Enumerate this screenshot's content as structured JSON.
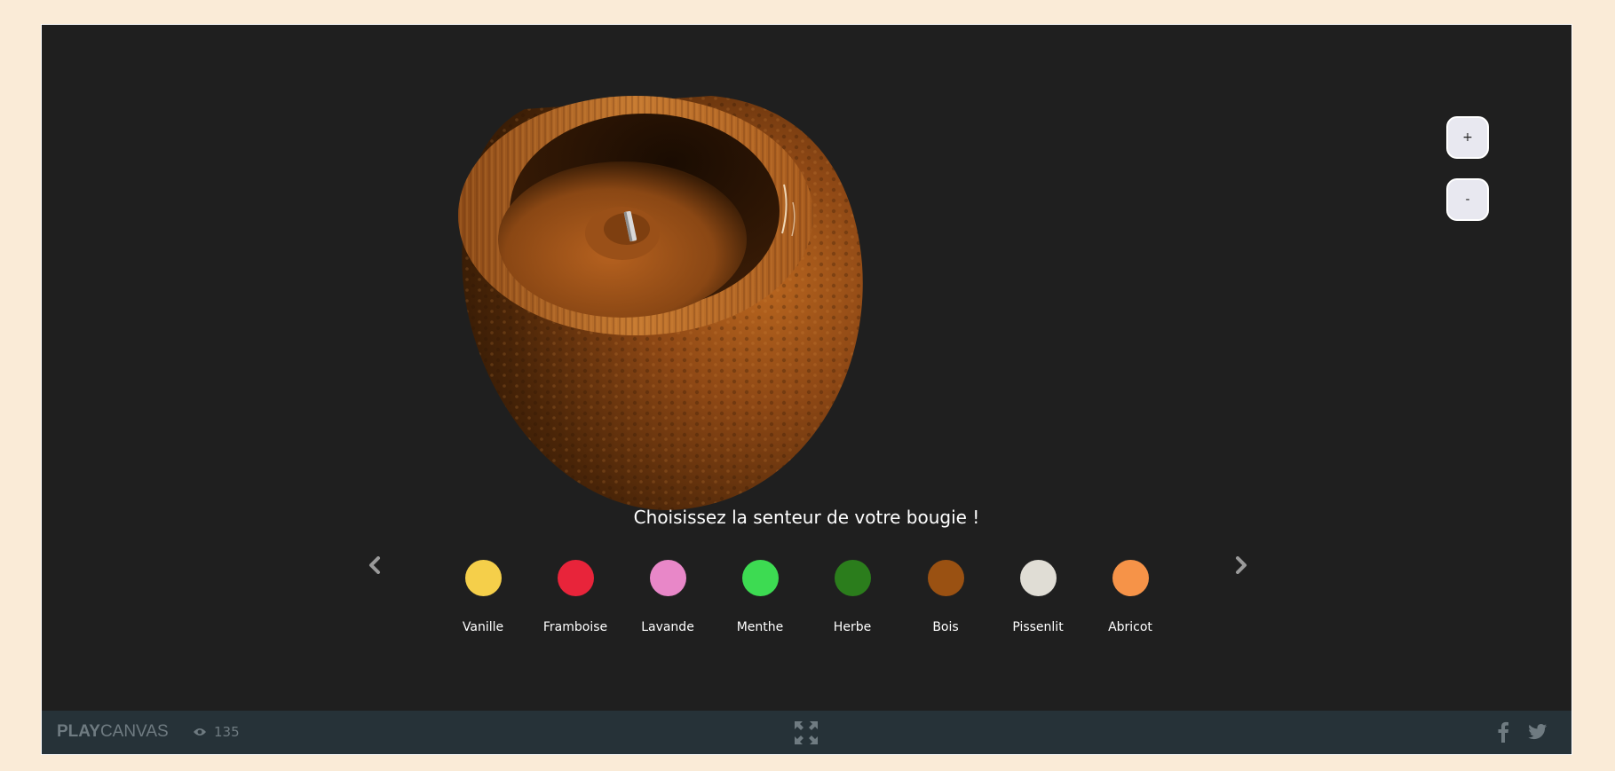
{
  "zoom": {
    "plus_label": "+",
    "minus_label": "-"
  },
  "prompt": "Choisissez la senteur de votre bougie !",
  "scents": [
    {
      "name": "Vanille",
      "color": "#f5cf4a"
    },
    {
      "name": "Framboise",
      "color": "#e8243a"
    },
    {
      "name": "Lavande",
      "color": "#e887c8"
    },
    {
      "name": "Menthe",
      "color": "#3ddb52"
    },
    {
      "name": "Herbe",
      "color": "#2b7d1c"
    },
    {
      "name": "Bois",
      "color": "#9a5112"
    },
    {
      "name": "Pissenlit",
      "color": "#e0ddd5"
    },
    {
      "name": "Abricot",
      "color": "#f69348"
    }
  ],
  "footer": {
    "logo_play": "PLAY",
    "logo_canvas": "CANVAS",
    "view_count": "135"
  },
  "icons": {
    "prev": "chevron-left-icon",
    "next": "chevron-right-icon",
    "views": "eye-icon",
    "fullscreen": "fullscreen-icon",
    "facebook": "facebook-icon",
    "twitter": "twitter-icon"
  },
  "colors": {
    "page_background": "#faebd7",
    "canvas_background": "#1f1f1f",
    "footer_background": "#263238",
    "footer_text": "#6f7b81",
    "candle_wood": "#a0531c"
  }
}
